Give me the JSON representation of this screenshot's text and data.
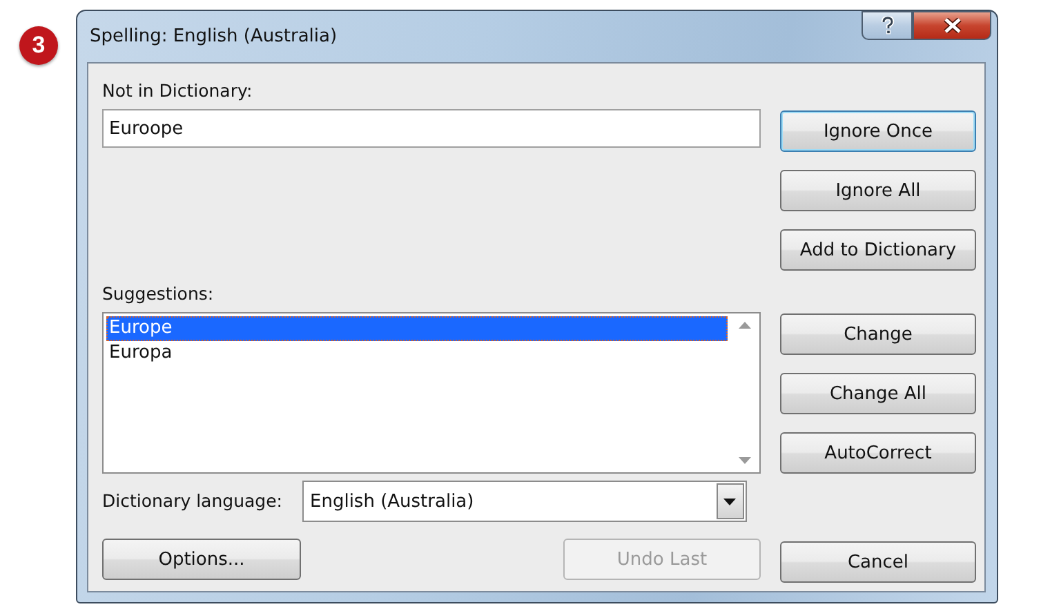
{
  "badge": "3",
  "window": {
    "title": "Spelling: English (Australia)"
  },
  "not_in_dictionary": {
    "label": "Not in Dictionary:",
    "value": "Euroope"
  },
  "suggestions": {
    "label": "Suggestions:",
    "items": [
      {
        "text": "Europe",
        "selected": true
      },
      {
        "text": "Europa",
        "selected": false
      }
    ]
  },
  "dictionary_language": {
    "label": "Dictionary language:",
    "value": "English (Australia)"
  },
  "ignore_buttons": [
    {
      "label": "Ignore Once",
      "default": true,
      "disabled": false
    },
    {
      "label": "Ignore All",
      "default": false,
      "disabled": false
    },
    {
      "label": "Add to Dictionary",
      "default": false,
      "disabled": false
    }
  ],
  "change_buttons": [
    {
      "label": "Change",
      "default": false,
      "disabled": false
    },
    {
      "label": "Change All",
      "default": false,
      "disabled": false
    },
    {
      "label": "AutoCorrect",
      "default": false,
      "disabled": false
    }
  ],
  "bottom_buttons": [
    {
      "label": "Options...",
      "default": false,
      "disabled": false
    },
    {
      "label": "Undo Last",
      "default": false,
      "disabled": true
    }
  ],
  "cancel_button": {
    "label": "Cancel",
    "default": false,
    "disabled": false
  }
}
